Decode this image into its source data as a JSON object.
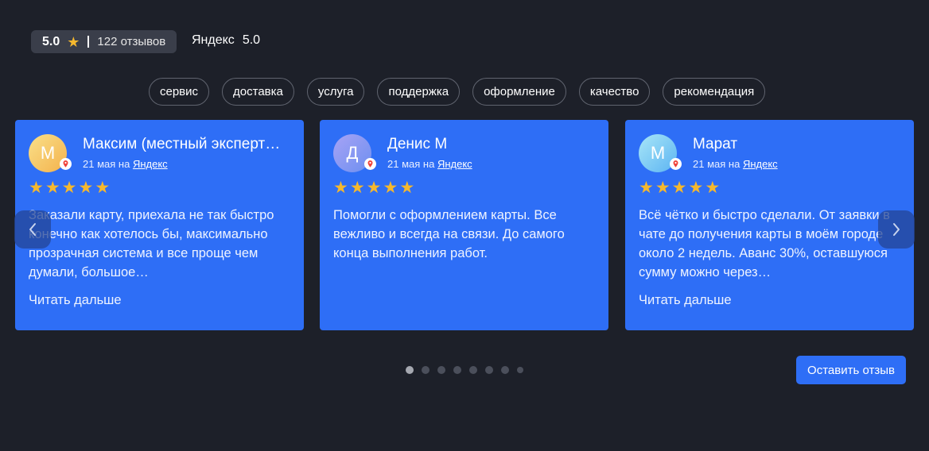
{
  "header": {
    "rating": "5.0",
    "reviews_count": "122 отзывов",
    "source_name": "Яндекс",
    "source_rating": "5.0"
  },
  "tags": [
    "сервис",
    "доставка",
    "услуга",
    "поддержка",
    "оформление",
    "качество",
    "рекомендация"
  ],
  "reviews": [
    {
      "initial": "М",
      "author": "Максим (местный эксперт…",
      "date": "21 мая на",
      "source": "Яндекс",
      "stars": 5,
      "text": "Заказали карту, приехала не так быстро конечно как хотелось бы, максимально прозрачная система и все проще чем думали, большое…",
      "read_more": "Читать дальше",
      "avatar_colors": [
        "#f9e08a",
        "#f4b24c"
      ]
    },
    {
      "initial": "Д",
      "author": "Денис М",
      "date": "21 мая на",
      "source": "Яндекс",
      "stars": 5,
      "text": "Помогли с оформлением карты. Все вежливо и всегда на связи. До самого конца выполнения работ.",
      "read_more": "",
      "avatar_colors": [
        "#a7a3f5",
        "#6d8ff0"
      ]
    },
    {
      "initial": "М",
      "author": "Марат",
      "date": "21 мая на",
      "source": "Яндекс",
      "stars": 5,
      "text": "Всё чётко и быстро сделали. От заявки в чате до получения карты в моём городе около 2 недель. Аванс 30%, оставшуюся сумму можно через…",
      "read_more": "Читать дальше",
      "avatar_colors": [
        "#a8e6f7",
        "#5cb4f2"
      ]
    }
  ],
  "pagination": {
    "total": 8,
    "active": 0
  },
  "actions": {
    "leave_review": "Оставить отзыв"
  },
  "colors": {
    "card": "#2e6ef6",
    "star": "#f5b82e",
    "background": "#1d2029"
  }
}
